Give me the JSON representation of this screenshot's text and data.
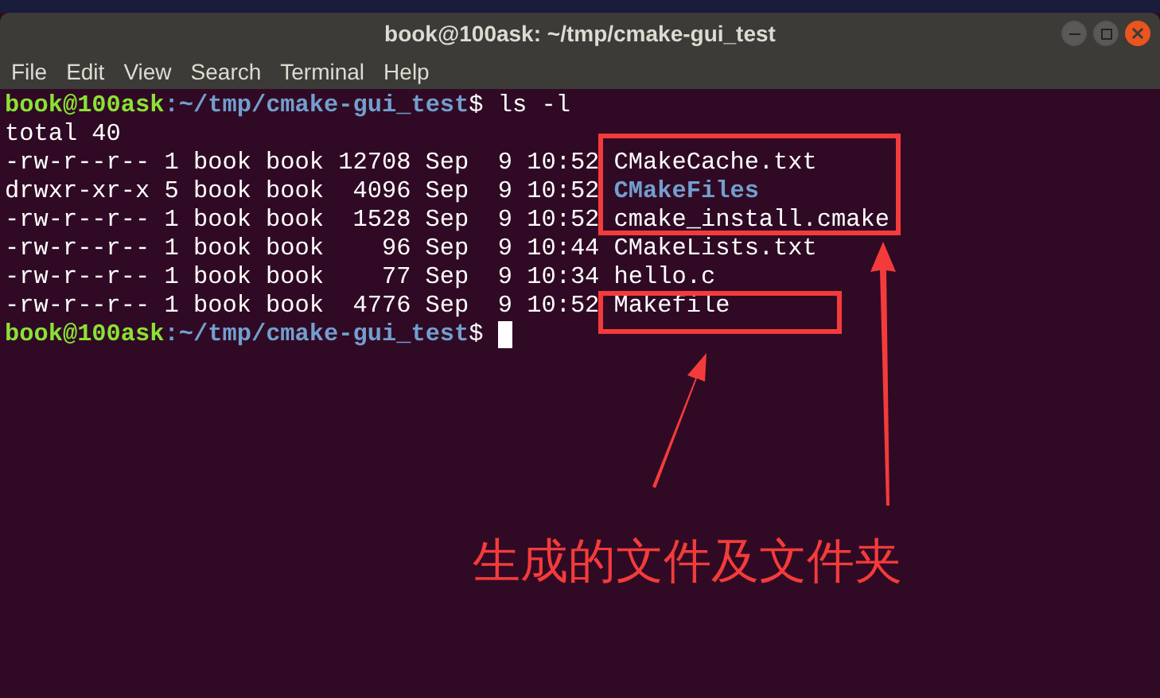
{
  "window": {
    "title": "book@100ask: ~/tmp/cmake-gui_test"
  },
  "menu": [
    "File",
    "Edit",
    "View",
    "Search",
    "Terminal",
    "Help"
  ],
  "terminal": {
    "lines": [
      {
        "kind": "prompt",
        "user_host": "book@100ask",
        "path": ":~/tmp/cmake-gui_test",
        "command": "$ ls -l"
      },
      {
        "kind": "output",
        "text": "total 40"
      },
      {
        "kind": "entry",
        "info": "-rw-r--r-- 1 book book 12708 Sep  9 10:52",
        "name": "CMakeCache.txt",
        "directory": false
      },
      {
        "kind": "entry",
        "info": "drwxr-xr-x 5 book book  4096 Sep  9 10:52",
        "name": "CMakeFiles",
        "directory": true
      },
      {
        "kind": "entry",
        "info": "-rw-r--r-- 1 book book  1528 Sep  9 10:52",
        "name": "cmake_install.cmake",
        "directory": false
      },
      {
        "kind": "entry",
        "info": "-rw-r--r-- 1 book book    96 Sep  9 10:44",
        "name": "CMakeLists.txt",
        "directory": false
      },
      {
        "kind": "entry",
        "info": "-rw-r--r-- 1 book book    77 Sep  9 10:34",
        "name": "hello.c",
        "directory": false
      },
      {
        "kind": "entry",
        "info": "-rw-r--r-- 1 book book  4776 Sep  9 10:52",
        "name": "Makefile",
        "directory": false
      },
      {
        "kind": "prompt",
        "user_host": "book@100ask",
        "path": ":~/tmp/cmake-gui_test",
        "command": "$",
        "cursor": true
      }
    ]
  },
  "annotation": {
    "caption": "生成的文件及文件夹"
  }
}
